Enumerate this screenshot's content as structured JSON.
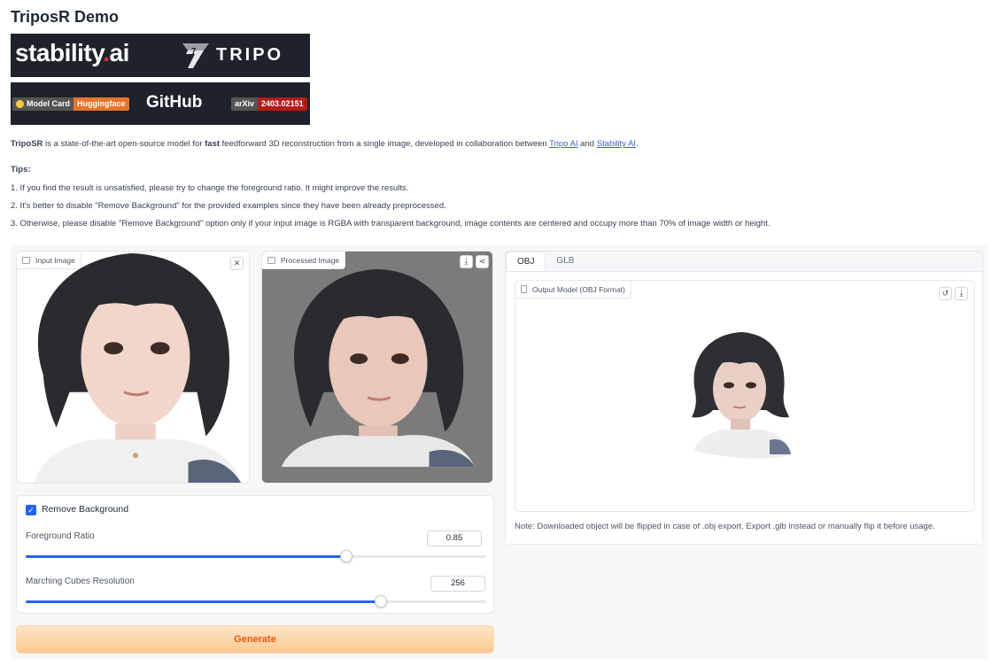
{
  "page": {
    "title": "TriposR Demo"
  },
  "banners": {
    "stability": {
      "text_main": "stability",
      "text_dot": ".",
      "text_suffix": "ai"
    },
    "tripo": {
      "text": "TRIPO"
    },
    "model_card": {
      "left": "Model Card",
      "right": "Huggingface"
    },
    "github": {
      "text": "GitHub"
    },
    "arxiv": {
      "left": "arXiv",
      "right": "2403.02151"
    }
  },
  "description": {
    "brand": "TripoSR",
    "part1": " is a state-of-the-art open-source model for ",
    "bold": "fast",
    "part2": " feedforward 3D reconstruction from a single image, developed in collaboration between ",
    "link1": "Tripo AI",
    "and": " and ",
    "link2": "Stability AI",
    "end": "."
  },
  "tips": {
    "heading": "Tips:",
    "items": [
      "1. If you find the result is unsatisfied, please try to change the foreground ratio. It might improve the results.",
      "2. It's better to disable \"Remove Background\" for the provided examples since they have been already preprocessed.",
      "3. Otherwise, please disable \"Remove Background\" option only if your input image is RGBA with transparent background, image contents are centered and occupy more than 70% of image width or height."
    ]
  },
  "input_image": {
    "label": "Input Image",
    "close_icon": "close-icon",
    "glyph_close": "✕"
  },
  "processed_image": {
    "label": "Processed Image",
    "glyph_download": "⤓",
    "glyph_share": "⋖"
  },
  "controls": {
    "remove_background": {
      "label": "Remove Background",
      "checked": true,
      "glyph": "✓"
    },
    "foreground_ratio": {
      "label": "Foreground Ratio",
      "value": "0.85",
      "fraction": 0.696
    },
    "marching_cubes": {
      "label": "Marching Cubes Resolution",
      "value": "256",
      "fraction": 0.771
    }
  },
  "generate_button": {
    "label": "Generate"
  },
  "output": {
    "tabs": [
      "OBJ",
      "GLB"
    ],
    "active_tab": "OBJ",
    "label": "Output Model (OBJ Format)",
    "glyph_reset": "↺",
    "glyph_download": "⤓",
    "note": "Note: Downloaded object will be flipped in case of .obj export. Export .glb instead or manually flip it before usage."
  },
  "colors": {
    "accent": "#2563eb",
    "generate_text": "#ea580c",
    "link": "#3b5fc4"
  }
}
